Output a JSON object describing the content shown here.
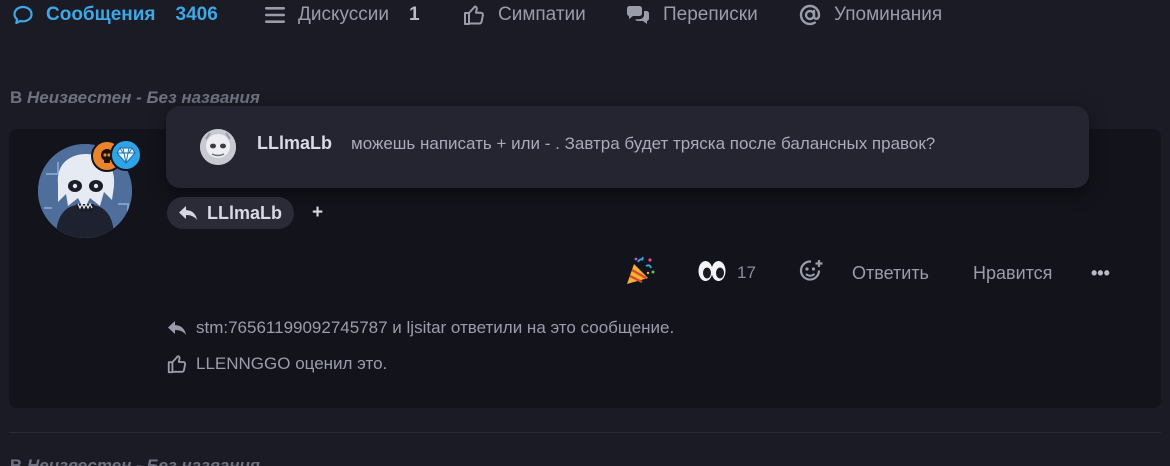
{
  "tabs": [
    {
      "label": "Сообщения",
      "count": "3406",
      "icon": "speech-bubble-icon",
      "active": true
    },
    {
      "label": "Дискуссии",
      "count": "1",
      "icon": "list-icon",
      "active": false
    },
    {
      "label": "Симпатии",
      "count": "",
      "icon": "thumbs-up-icon",
      "active": false
    },
    {
      "label": "Переписки",
      "count": "",
      "icon": "conversations-icon",
      "active": false
    },
    {
      "label": "Упоминания",
      "count": "",
      "icon": "at-sign-icon",
      "active": false
    }
  ],
  "section": {
    "prefix": "В",
    "thread": "Неизвестен - Без названия"
  },
  "popover": {
    "username": "LLlmaLb",
    "message": "можешь написать + или - . Завтра будет тряска после балансных правок?"
  },
  "quote": {
    "username": "LLlmaLb",
    "extra": "+"
  },
  "actions": {
    "reaction_party_icon": "party-popper-icon",
    "reaction_eyes_icon": "eyes-icon",
    "reaction_eyes_count": "17",
    "add_reaction_icon": "add-reaction-icon",
    "reply_label": "Ответить",
    "like_label": "Нравится",
    "more_label": "•••"
  },
  "footer": {
    "replies_text": "stm:76561199092745787 и ljsitar ответили на это сообщение.",
    "likes_text": "LLENNGGO оценил это."
  },
  "colors": {
    "background": "#1a1b24",
    "card": "#13141b",
    "accent": "#3ea7e6",
    "popover": "#242531",
    "badge_orange": "#e8852a",
    "badge_blue": "#2fa3e8"
  }
}
